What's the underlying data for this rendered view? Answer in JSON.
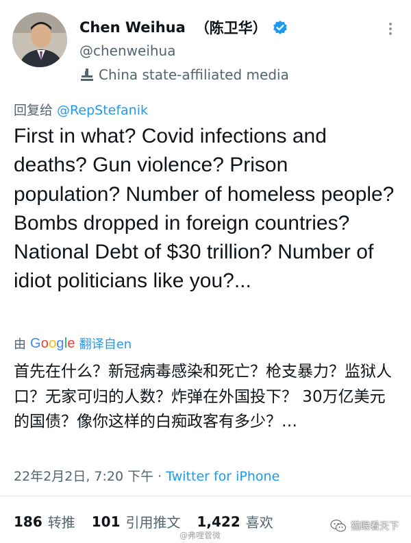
{
  "profile": {
    "display_name": "Chen Weihua",
    "cjk_name": "（陈卫华）",
    "handle": "@chenweihua",
    "affiliation": "China state-affiliated media"
  },
  "reply": {
    "prefix": "回复给 ",
    "mention": "@RepStefanik"
  },
  "tweet": {
    "text": "First in what? Covid infections and deaths? Gun violence? Prison population? Number of homeless people? Bombs dropped in foreign countries? National Debt of $30 trillion? Number of idiot politicians like you?..."
  },
  "translation": {
    "by": "由",
    "google": [
      "G",
      "o",
      "o",
      "g",
      "l",
      "e"
    ],
    "link": "翻译自en",
    "text": "首先在什么？新冠病毒感染和死亡？枪支暴力？监狱人口？无家可归的人数？炸弹在外国投下？ 30万亿美元的国债？像你这样的白痴政客有多少？…"
  },
  "meta": {
    "datetime": "22年2月2日, 7:20 下午 · ",
    "source": "Twitter for iPhone"
  },
  "stats": {
    "retweets_count": "186",
    "retweets_label": "转推",
    "quotes_count": "101",
    "quotes_label": "引用推文",
    "likes_count": "1,422",
    "likes_label": "喜欢"
  },
  "watermarks": {
    "center": "@弗哩菅微",
    "right": "猫眼看天下"
  },
  "colors": {
    "link": "#1d9bf0",
    "muted": "#536471",
    "text": "#0f1419",
    "verified": "#1d9bf0"
  },
  "icons": {
    "verified": "verified-badge-icon",
    "affiliation": "state-media-icon",
    "more": "more-options-icon",
    "wechat": "wechat-icon"
  }
}
